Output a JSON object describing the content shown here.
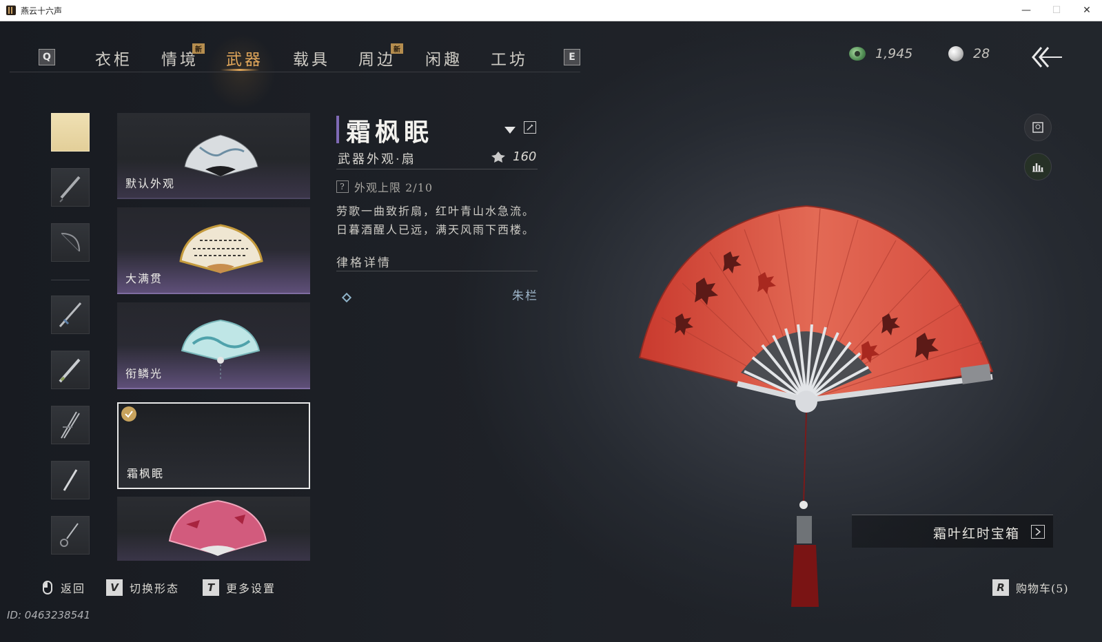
{
  "window": {
    "title": "燕云十六声",
    "minimize": "—",
    "maximize": "☐",
    "close": "✕"
  },
  "nav": {
    "key_left": "Q",
    "key_right": "E",
    "tabs": [
      {
        "label": "衣柜"
      },
      {
        "label": "情境",
        "badge": "新"
      },
      {
        "label": "武器",
        "active": true
      },
      {
        "label": "载具"
      },
      {
        "label": "周边",
        "badge": "新"
      },
      {
        "label": "闲趣"
      },
      {
        "label": "工坊"
      }
    ]
  },
  "currency": {
    "jade": "1,945",
    "pearl": "28"
  },
  "categories": [
    {
      "icon": "color-swatch-icon",
      "selected": true
    },
    {
      "icon": "umbrella-icon"
    },
    {
      "icon": "bow-icon"
    },
    {
      "icon": "sword-icon"
    },
    {
      "icon": "spear-icon"
    },
    {
      "icon": "dual-blades-icon"
    },
    {
      "icon": "staff-icon"
    },
    {
      "icon": "rope-dart-icon"
    }
  ],
  "items": [
    {
      "label": "默认外观"
    },
    {
      "label": "大满贯"
    },
    {
      "label": "衔鳞光"
    },
    {
      "label": "霜枫眠",
      "selected": true,
      "equipped": true
    },
    {
      "label": ""
    }
  ],
  "detail": {
    "title": "霜枫眠",
    "subtitle": "武器外观·扇",
    "price": "160",
    "limit": "外观上限 2/10",
    "limit_icon": "?",
    "poem_line1": "劳歌一曲致折扇，红叶青山水急流。",
    "poem_line2": "日暮酒醒人已远，满天风雨下西楼。",
    "section_title": "律格详情",
    "rule_name": "朱栏"
  },
  "chest": {
    "label": "霜叶红时宝箱"
  },
  "bottom_hints": {
    "back": "返回",
    "switch_key": "V",
    "switch": "切换形态",
    "more_key": "T",
    "more": "更多设置",
    "cart_key": "R",
    "cart": "购物车(5)"
  },
  "footer": {
    "id": "ID: 0463238541"
  },
  "colors": {
    "accent_gold": "#e0a65a",
    "accent_purple": "#7f6ab5",
    "fan_red": "#d9473a"
  }
}
